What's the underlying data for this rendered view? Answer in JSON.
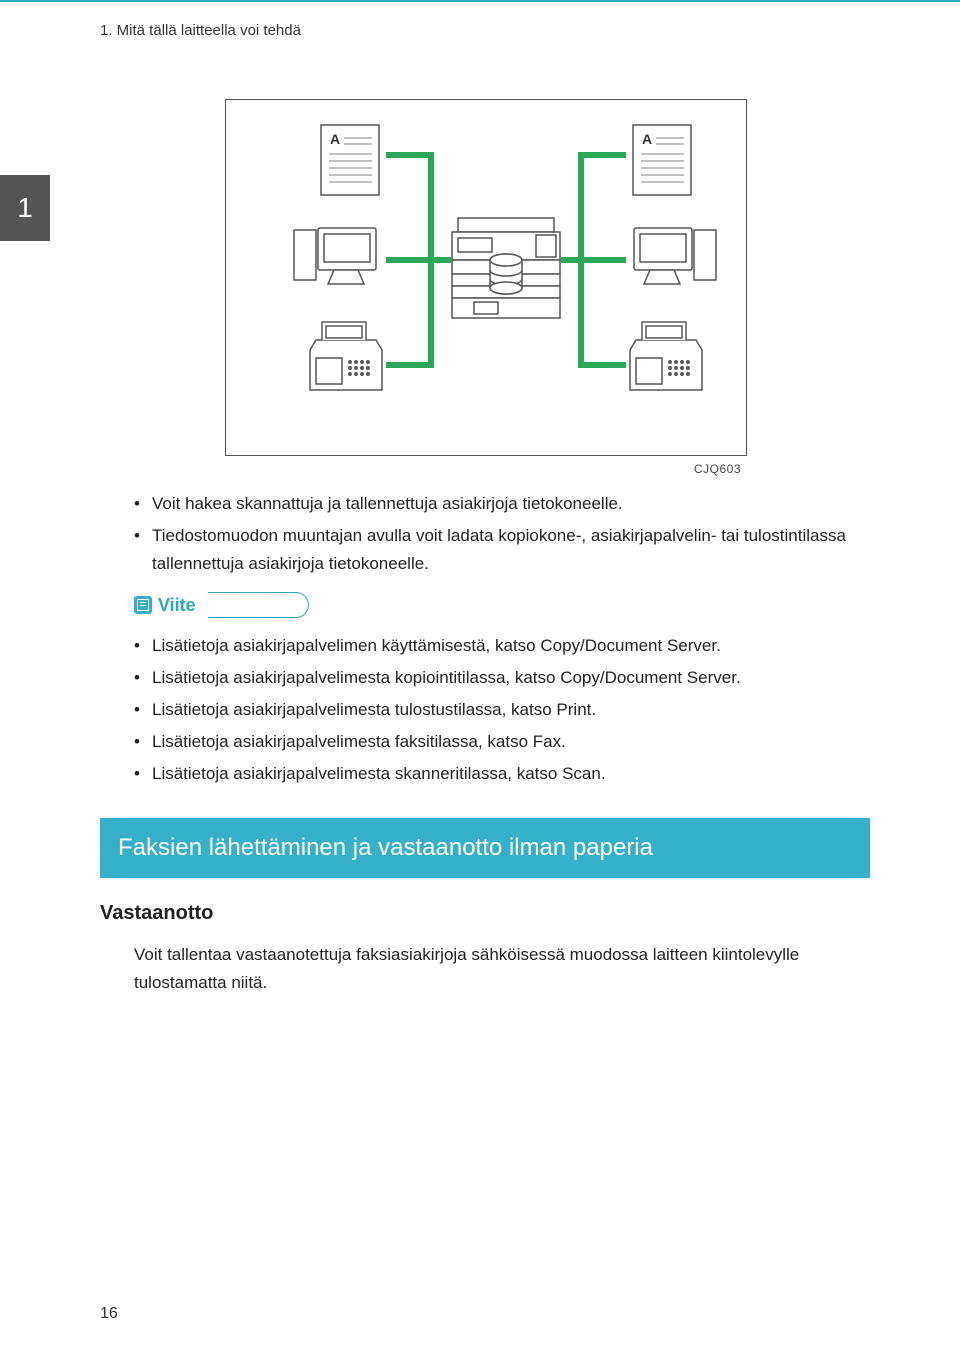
{
  "header": {
    "chapter_title": "1. Mitä tällä laitteella voi tehdä",
    "chapter_tab": "1"
  },
  "diagram": {
    "doc_label": "A",
    "figure_code": "CJQ603"
  },
  "intro_bullets": [
    "Voit hakea skannattuja ja tallennettuja asiakirjoja tietokoneelle.",
    "Tiedostomuodon muuntajan avulla voit ladata kopiokone-, asiakirjapalvelin- tai tulostintilassa tallennettuja asiakirjoja tietokoneelle."
  ],
  "viite": {
    "label": "Viite",
    "bullets": [
      "Lisätietoja asiakirjapalvelimen käyttämisestä, katso Copy/Document Server.",
      "Lisätietoja asiakirjapalvelimesta kopiointitilassa, katso Copy/Document Server.",
      "Lisätietoja asiakirjapalvelimesta tulostustilassa, katso Print.",
      "Lisätietoja asiakirjapalvelimesta faksitilassa, katso Fax.",
      "Lisätietoja asiakirjapalvelimesta skanneritilassa, katso Scan."
    ]
  },
  "section": {
    "banner": "Faksien lähettäminen ja vastaanotto ilman paperia",
    "sub_heading": "Vastaanotto",
    "body": "Voit tallentaa vastaanotettuja faksiasiakirjoja sähköisessä muodossa laitteen kiintolevylle tulostamatta niitä."
  },
  "page_number": "16"
}
